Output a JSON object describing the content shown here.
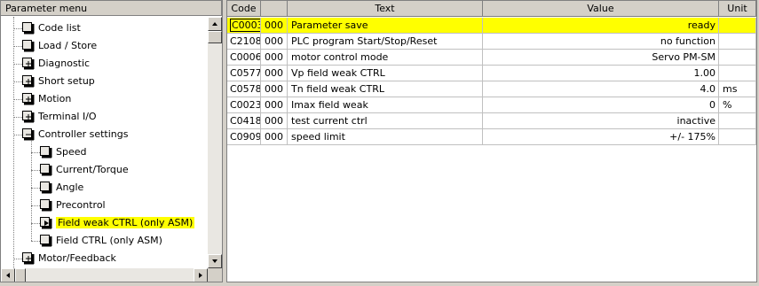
{
  "tree": {
    "header": "Parameter menu",
    "items": [
      {
        "label": "Code list",
        "level": 0,
        "expander": "none"
      },
      {
        "label": "Load / Store",
        "level": 0,
        "expander": "none"
      },
      {
        "label": "Diagnostic",
        "level": 0,
        "expander": "plus"
      },
      {
        "label": "Short setup",
        "level": 0,
        "expander": "plus"
      },
      {
        "label": "Motion",
        "level": 0,
        "expander": "plus"
      },
      {
        "label": "Terminal I/O",
        "level": 0,
        "expander": "plus"
      },
      {
        "label": "Controller settings",
        "level": 0,
        "expander": "minus"
      },
      {
        "label": "Speed",
        "level": 1,
        "expander": "none"
      },
      {
        "label": "Current/Torque",
        "level": 1,
        "expander": "none"
      },
      {
        "label": "Angle",
        "level": 1,
        "expander": "none"
      },
      {
        "label": "Precontrol",
        "level": 1,
        "expander": "none"
      },
      {
        "label": "Field weak CTRL (only ASM)",
        "level": 1,
        "expander": "none",
        "selected": true
      },
      {
        "label": "Field CTRL (only ASM)",
        "level": 1,
        "expander": "none"
      },
      {
        "label": "Motor/Feedback",
        "level": 0,
        "expander": "plus"
      }
    ]
  },
  "table": {
    "headers": {
      "code": "Code",
      "sub": "",
      "text": "Text",
      "value": "Value",
      "unit": "Unit"
    },
    "rows": [
      {
        "code": "C0003",
        "sub": "000",
        "text": "Parameter save",
        "value": "ready",
        "unit": "",
        "highlight": true
      },
      {
        "code": "C2108",
        "sub": "000",
        "text": "PLC program Start/Stop/Reset",
        "value": "no function",
        "unit": ""
      },
      {
        "code": "C0006",
        "sub": "000",
        "text": "motor control mode",
        "value": "Servo PM-SM",
        "unit": ""
      },
      {
        "code": "C0577",
        "sub": "000",
        "text": "Vp field weak CTRL",
        "value": "1.00",
        "unit": ""
      },
      {
        "code": "C0578",
        "sub": "000",
        "text": "Tn field weak CTRL",
        "value": "4.0",
        "unit": "ms"
      },
      {
        "code": "C0023",
        "sub": "000",
        "text": "Imax field weak",
        "value": "0",
        "unit": "%"
      },
      {
        "code": "C0418",
        "sub": "000",
        "text": "test current ctrl",
        "value": "inactive",
        "unit": ""
      },
      {
        "code": "C0909",
        "sub": "000",
        "text": "speed limit",
        "value": "+/- 175%",
        "unit": ""
      }
    ]
  },
  "colors": {
    "highlight": "#ffff00",
    "chrome": "#d4d0c8"
  }
}
